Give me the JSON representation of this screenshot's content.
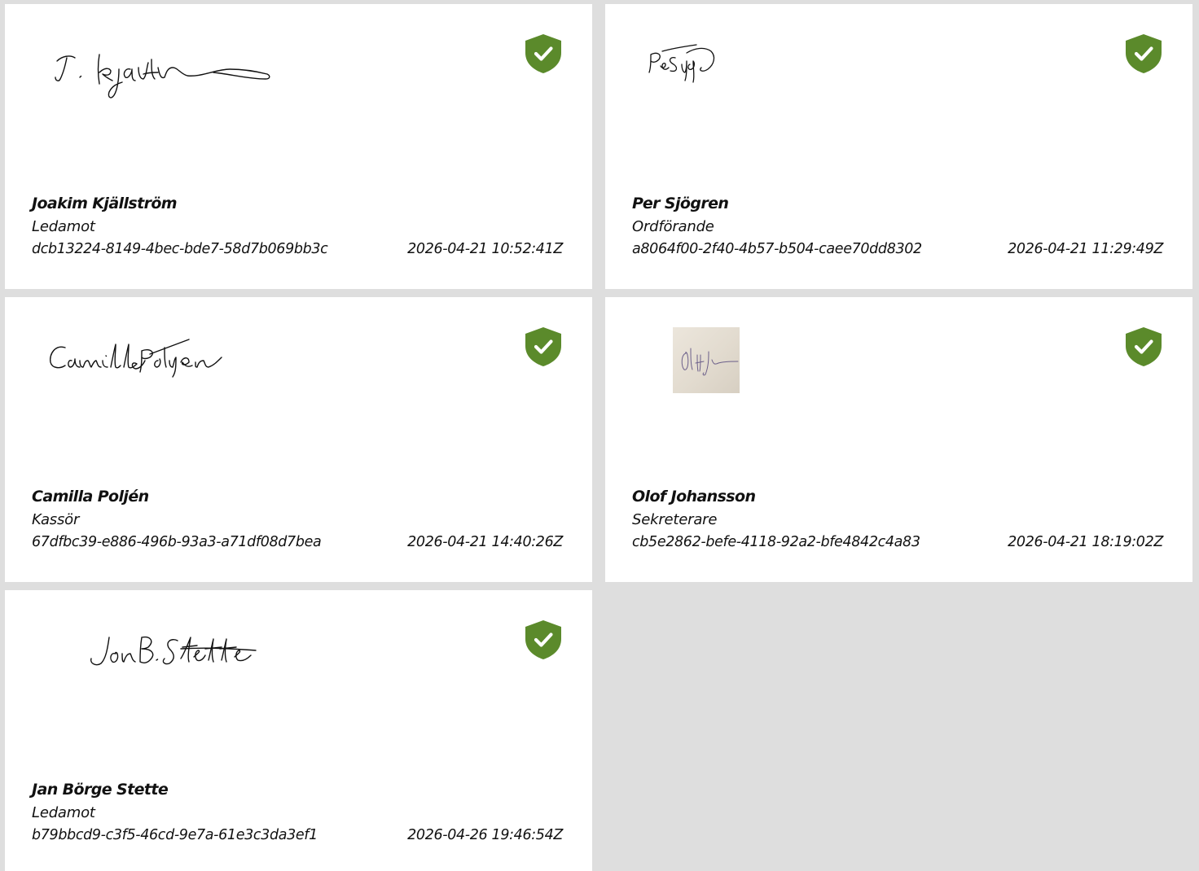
{
  "signatures": [
    {
      "name": "Joakim Kjällström",
      "role": "Ledamot",
      "id": "dcb13224-8149-4bec-bde7-58d7b069bb3c",
      "timestamp": "2026-04-21 10:52:41Z",
      "signature_text": "J. Kjällström",
      "status_icon": "verified-shield-icon"
    },
    {
      "name": "Per Sjögren",
      "role": "Ordförande",
      "id": "a8064f00-2f40-4b57-b504-caee70dd8302",
      "timestamp": "2026-04-21 11:29:49Z",
      "signature_text": "Per Sjögren",
      "status_icon": "verified-shield-icon"
    },
    {
      "name": "Camilla Poljén",
      "role": "Kassör",
      "id": "67dfbc39-e886-496b-93a3-a71df08d7bea",
      "timestamp": "2026-04-21 14:40:26Z",
      "signature_text": "Camilla Poljén",
      "status_icon": "verified-shield-icon"
    },
    {
      "name": "Olof Johansson",
      "role": "Sekreterare",
      "id": "cb5e2862-befe-4118-92a2-bfe4842c4a83",
      "timestamp": "2026-04-21 18:19:02Z",
      "signature_text": "Olof Johansson",
      "status_icon": "verified-shield-icon"
    },
    {
      "name": "Jan Börge Stette",
      "role": "Ledamot",
      "id": "b79bbcd9-c3f5-46cd-9e7a-61e3c3da3ef1",
      "timestamp": "2026-04-26 19:46:54Z",
      "signature_text": "Jon B. Stette",
      "status_icon": "verified-shield-icon"
    }
  ],
  "colors": {
    "verified": "#5b8a2b",
    "background": "#dedede",
    "card": "#ffffff"
  }
}
